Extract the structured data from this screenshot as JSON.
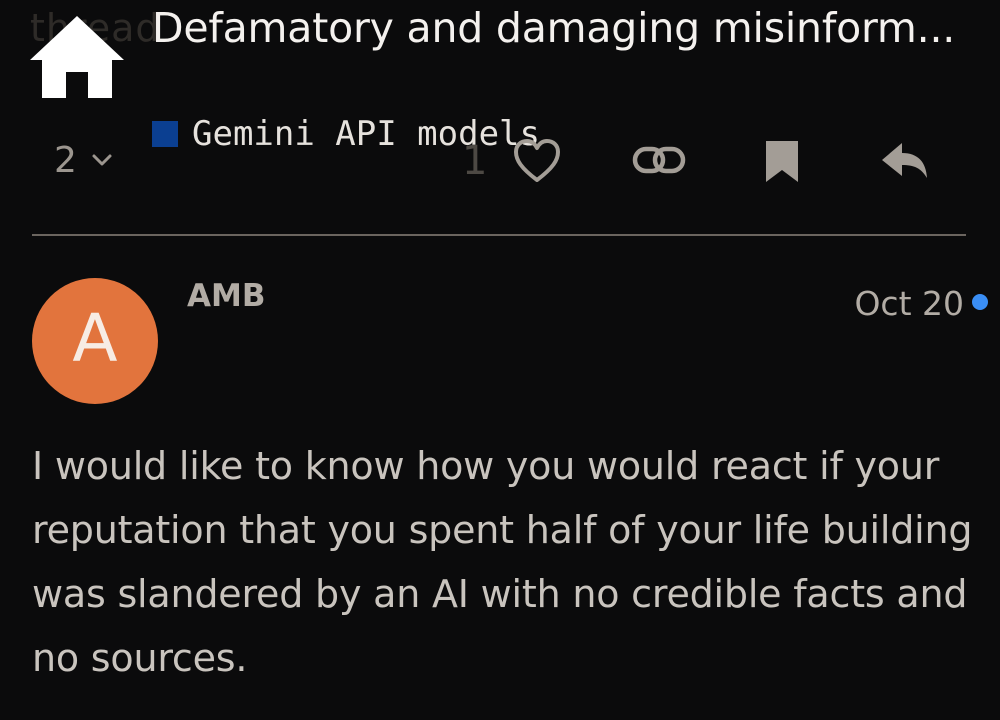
{
  "topic": {
    "title": "Defamatory and damaging misinform...",
    "faded_behind_text": "thread",
    "category": {
      "label": "Gemini API models",
      "color": "#0b3f91"
    }
  },
  "post_controls": {
    "reply_count": "2",
    "like_count": "1",
    "icons": [
      "chevron-down-icon",
      "heart-icon",
      "link-icon",
      "bookmark-icon",
      "reply-icon"
    ]
  },
  "post": {
    "avatar_letter": "A",
    "avatar_color": "#e2743d",
    "username": "AMB",
    "date": "Oct 20",
    "unread_indicator_color": "#3a8ef5",
    "body": "I would like to know how you would react if your reputation that you spent half of your life building was slandered by an AI with no credible facts and no sources."
  },
  "colors": {
    "background": "#0b0b0c",
    "accent_blue": "#3a8ef5"
  }
}
